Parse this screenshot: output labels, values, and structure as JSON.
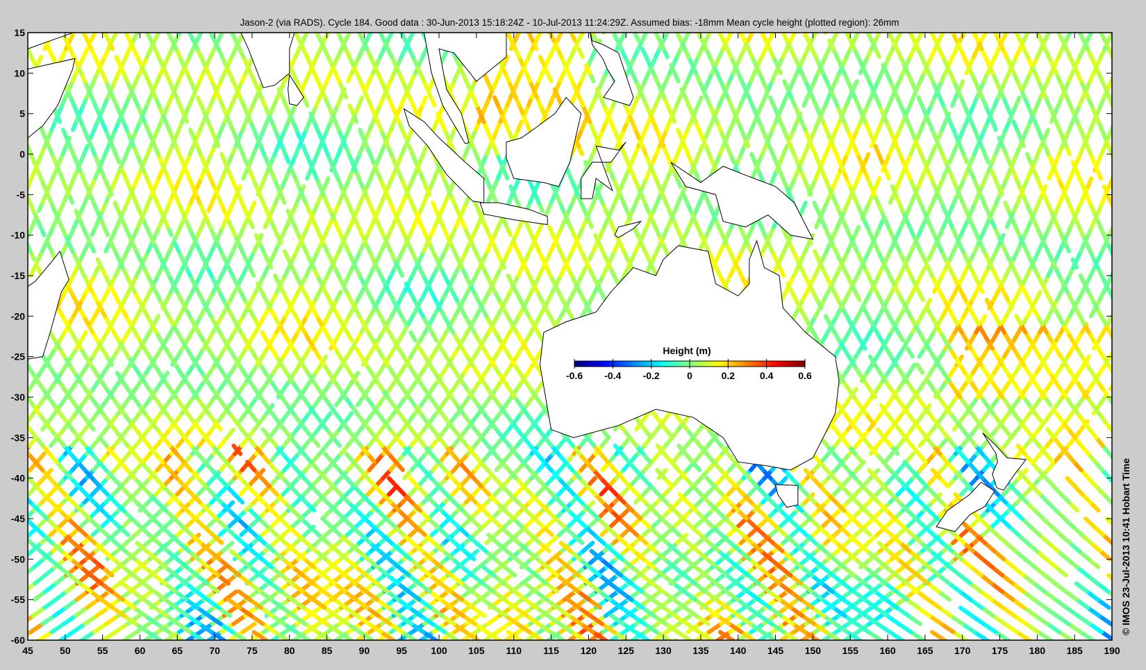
{
  "chart_data": {
    "type": "scatter",
    "title": "Jason-2 (via RADS). Cycle 184. Good data : 30-Jun-2013 15:18:24Z - 10-Jul-2013 11:24:29Z. Assumed bias: -18mm  Mean cycle height (plotted region): 26mm",
    "xlabel": "",
    "ylabel": "",
    "xlim": [
      45,
      190
    ],
    "ylim": [
      -60,
      15
    ],
    "x_ticks": [
      "45",
      "50",
      "55",
      "60",
      "65",
      "70",
      "75",
      "80",
      "85",
      "90",
      "95",
      "100",
      "105",
      "110",
      "115",
      "120",
      "125",
      "130",
      "135",
      "140",
      "145",
      "150",
      "155",
      "160",
      "165",
      "170",
      "175",
      "180",
      "185",
      "190"
    ],
    "y_ticks": [
      "15",
      "10",
      "5",
      "0",
      "-5",
      "-10",
      "-15",
      "-20",
      "-25",
      "-30",
      "-35",
      "-40",
      "-45",
      "-50",
      "-55",
      "-60"
    ],
    "series_description": "Sea surface height anomaly along altimeter ground tracks",
    "mean_height_m": 0.026,
    "colorbar": {
      "label": "Height (m)",
      "range": [
        -0.6,
        0.6
      ],
      "tick_labels": [
        "-0.6",
        "-0.4",
        "-0.2",
        "0",
        "0.2",
        "0.4",
        "0.6"
      ],
      "colormap": "jet"
    },
    "credit": "© IMOS 23-Jul-2013 10:41 Hobart Time"
  },
  "colors": {
    "background": "#cccccc",
    "plot": "#ffffff",
    "land_outline": "#000000"
  }
}
